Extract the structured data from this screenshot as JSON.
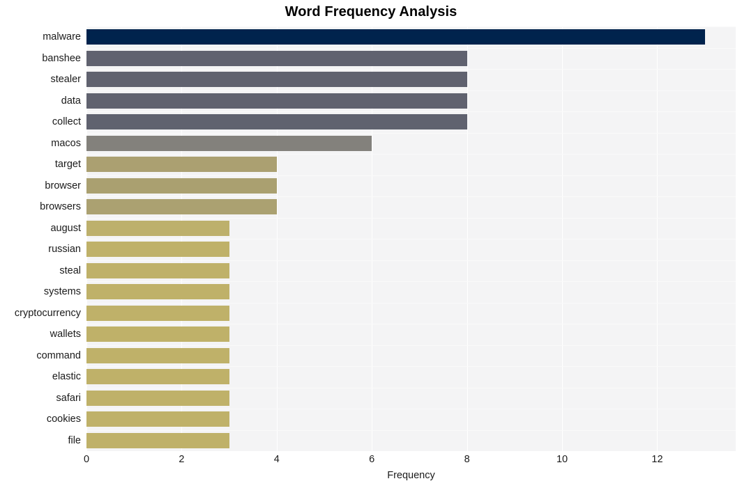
{
  "chart_data": {
    "type": "bar",
    "orientation": "horizontal",
    "title": "Word Frequency Analysis",
    "xlabel": "Frequency",
    "ylabel": "",
    "xlim": [
      0,
      13.65
    ],
    "xticks": [
      0,
      2,
      4,
      6,
      8,
      10,
      12
    ],
    "xticklabels": [
      "0",
      "2",
      "4",
      "6",
      "8",
      "10",
      "12"
    ],
    "grid": true,
    "legend": null,
    "categories": [
      "malware",
      "banshee",
      "stealer",
      "data",
      "collect",
      "macos",
      "target",
      "browser",
      "browsers",
      "august",
      "russian",
      "steal",
      "systems",
      "cryptocurrency",
      "wallets",
      "command",
      "elastic",
      "safari",
      "cookies",
      "file"
    ],
    "values": [
      13,
      8,
      8,
      8,
      8,
      6,
      4,
      4,
      4,
      3,
      3,
      3,
      3,
      3,
      3,
      3,
      3,
      3,
      3,
      3
    ],
    "bar_colors": [
      "#00234d",
      "#60626f",
      "#60626f",
      "#60626f",
      "#60626f",
      "#83817c",
      "#aba071",
      "#aaa070",
      "#aba171",
      "#bdb06c",
      "#bfb169",
      "#bfb169",
      "#bfb169",
      "#bfb169",
      "#bfb169",
      "#bfb169",
      "#bfb169",
      "#bfb169",
      "#bfb169",
      "#bfb169"
    ]
  },
  "colors": {
    "plot_background": "#f4f4f5",
    "figure_background": "#ffffff",
    "gridline": "#ffffff",
    "text": "#1a1a1a",
    "title": "#000000"
  }
}
